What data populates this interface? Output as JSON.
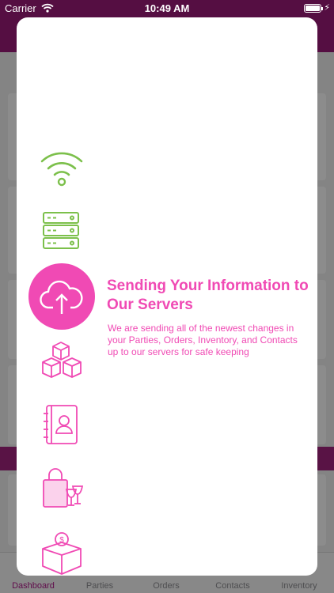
{
  "status_bar": {
    "carrier": "Carrier",
    "time": "10:49 AM"
  },
  "tab_bar": {
    "tabs": [
      "Dashboard",
      "Parties",
      "Orders",
      "Contacts",
      "Inventory"
    ]
  },
  "sync_modal": {
    "title": "Sending Your Information to Our Servers",
    "description": "We are sending all of the newest changes in your Parties, Orders, Inventory, and Contacts up to our servers for safe keeping",
    "steps": [
      "wifi-icon",
      "server-icon",
      "cloud-upload-icon",
      "boxes-icon",
      "contacts-book-icon",
      "shopping-bag-icon",
      "money-box-icon"
    ],
    "colors": {
      "done": "#7cc04b",
      "pending": "#f04ab4",
      "active_bg": "#f04ab4"
    }
  }
}
